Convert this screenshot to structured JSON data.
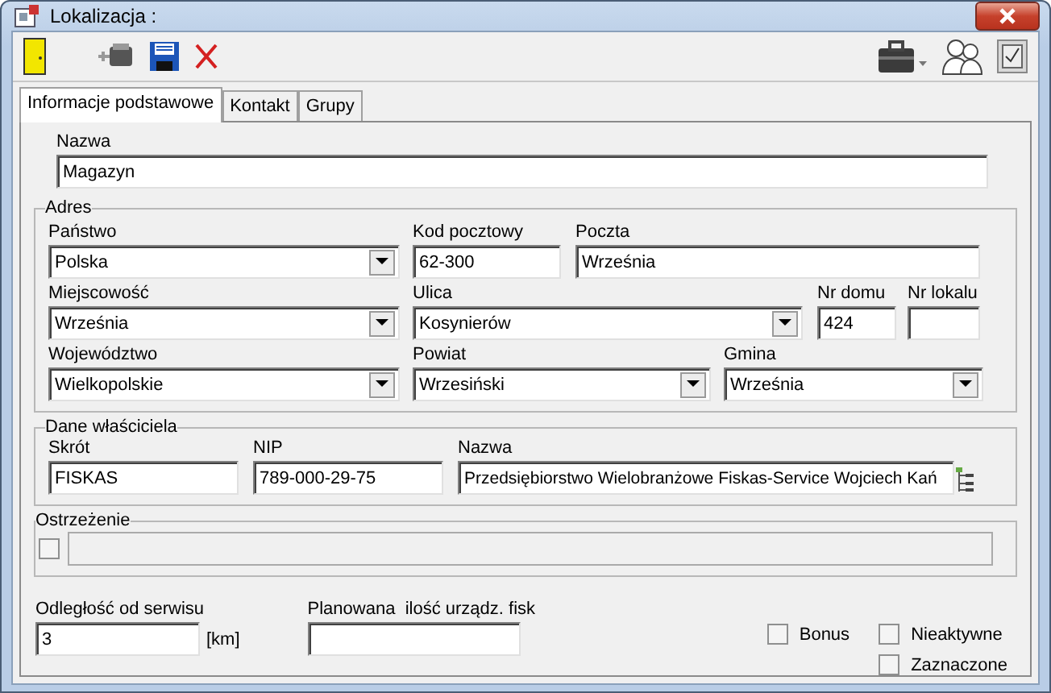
{
  "window": {
    "title": "Lokalizacja :"
  },
  "tabs": [
    {
      "label": "Informacje podstawowe",
      "selected": true
    },
    {
      "label": "Kontakt",
      "selected": false
    },
    {
      "label": "Grupy",
      "selected": false
    }
  ],
  "name_field": {
    "label": "Nazwa",
    "value": "Magazyn"
  },
  "address": {
    "title": "Adres",
    "rows": [
      [
        {
          "label": "Państwo",
          "value": "Polska",
          "kind": "combo"
        },
        {
          "label": "Kod pocztowy",
          "value": "62-300",
          "kind": "text"
        },
        {
          "label": "Poczta",
          "value": "Września",
          "kind": "text"
        }
      ],
      [
        {
          "label": "Miejscowość",
          "value": "Września",
          "kind": "combo"
        },
        {
          "label": "Ulica",
          "value": "Kosynierów",
          "kind": "combo"
        },
        {
          "label": "Nr domu",
          "value": "424",
          "kind": "text"
        },
        {
          "label": "Nr lokalu",
          "kind": "text"
        }
      ],
      [
        {
          "label": "Województwo",
          "value": "Wielkopolskie",
          "kind": "combo"
        },
        {
          "label": "Powiat",
          "value": "Wrzesiński",
          "kind": "combo"
        },
        {
          "label": "Gmina",
          "value": "Września",
          "kind": "combo"
        }
      ]
    ]
  },
  "owner": {
    "title": "Dane właściciela",
    "fields": [
      {
        "label": "Skrót",
        "value": "FISKAS",
        "kind": "text"
      },
      {
        "label": "NIP",
        "value": "789-000-29-75",
        "kind": "text"
      },
      {
        "label": "Nazwa",
        "value": "Przedsiębiorstwo Wielobranżowe Fiskas-Service Wojciech Kań",
        "kind": "text"
      }
    ]
  },
  "warning": {
    "title": "Ostrzeżenie",
    "checked": false
  },
  "distance": {
    "label": "Odległość od serwisu",
    "value": "3",
    "unit": "[km]"
  },
  "planned": {
    "label": "Planowana  ilość urządz. fisk"
  },
  "checkboxes": [
    {
      "label": "Bonus",
      "checked": false
    },
    {
      "label": "Nieaktywne",
      "checked": false
    },
    {
      "label": "Zaznaczone",
      "checked": false
    }
  ]
}
